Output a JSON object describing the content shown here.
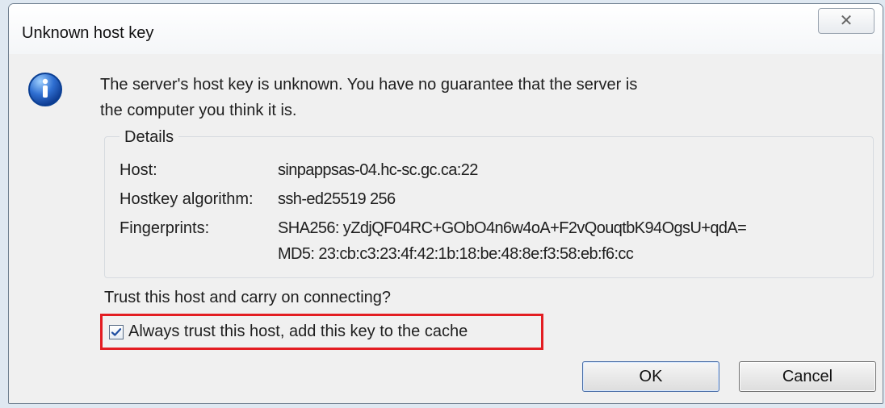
{
  "window": {
    "title": "Unknown host key",
    "close_icon": "close-icon"
  },
  "message": {
    "line1": "The server's host key is unknown. You have no guarantee that the server is",
    "line2": "the computer you think it is."
  },
  "details": {
    "label": "Details",
    "host_label": "Host:",
    "host_value": "sinpappsas-04.hc-sc.gc.ca:22",
    "algorithm_label": "Hostkey algorithm:",
    "algorithm_value": "ssh-ed25519 256",
    "fingerprints_label": "Fingerprints:",
    "fingerprint_sha256": "SHA256: yZdjQF04RC+GObO4n6w4oA+F2vQouqtbK94OgsU+qdA=",
    "fingerprint_md5": "MD5: 23:cb:c3:23:4f:42:1b:18:be:48:8e:f3:58:eb:f6:cc"
  },
  "trust": {
    "question": "Trust this host and carry on connecting?",
    "checkbox_label": "Always trust this host, add this key to the cache"
  },
  "buttons": {
    "ok": "OK",
    "cancel": "Cancel"
  },
  "icons": {
    "info": "info-icon",
    "checkmark": "checkmark-icon"
  },
  "colors": {
    "window_bg": "#f0f0f0",
    "title_bg": "#ffffff",
    "highlight": "#e31d22",
    "info_blue": "#2f6fd1"
  }
}
